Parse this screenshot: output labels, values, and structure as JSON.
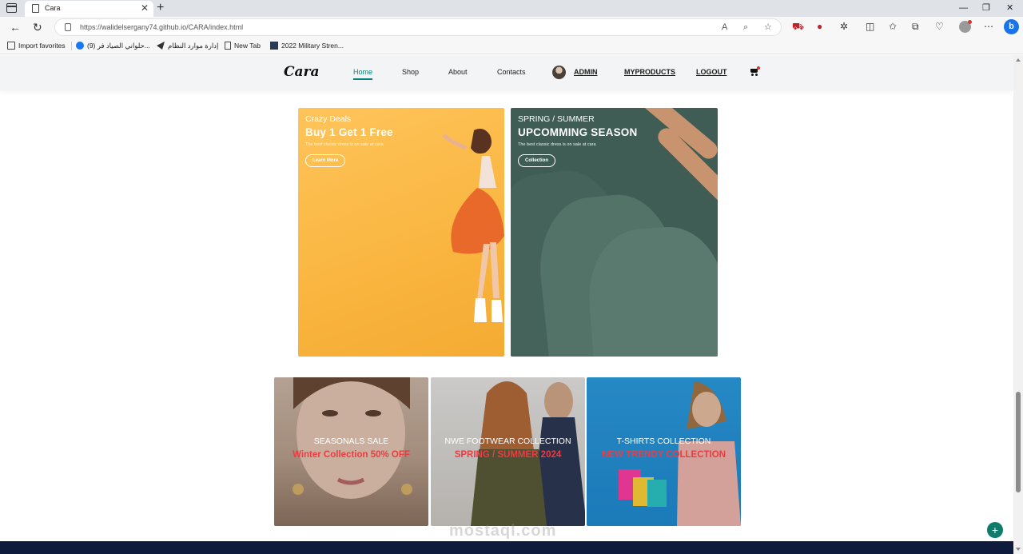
{
  "browser": {
    "tab_title": "Cara",
    "url": "https://walidelsergany74.github.io/CARA/index.html",
    "bookmarks": [
      "Import favorites",
      "(9) حلواني الصياد فر...",
      "إدارة موارد النظام",
      "New Tab",
      "2022 Military Stren..."
    ],
    "bing_label": "b"
  },
  "site": {
    "logo": "Cara",
    "nav": {
      "home": "Home",
      "shop": "Shop",
      "about": "About",
      "contacts": "Contacts",
      "admin": "ADMIN",
      "myproducts": "MYPRODUCTS",
      "logout": "LOGOUT"
    },
    "accent_color": "#088178",
    "banners": [
      {
        "small": "Crazy Deals",
        "big": "Buy 1 Get 1 Free",
        "desc": "The best classic dress is on sale at cara",
        "button": "Learn More"
      },
      {
        "small": "SPRING / SUMMER",
        "big": "UPCOMMING SEASON",
        "desc": "The best classic dress is on sale at cara",
        "button": "Collection"
      }
    ],
    "promos": [
      {
        "title": "SEASONALS SALE",
        "sub": "Winter Collection 50% OFF"
      },
      {
        "title": "NWE FOOTWEAR COLLECTION",
        "sub": "SPRING / SUMMER 2024"
      },
      {
        "title": "T-SHIRTS COLLECTION",
        "sub": "NEW TRENDY COLLECTION"
      }
    ],
    "watermark": "mostaql.com",
    "fab_label": "+"
  }
}
